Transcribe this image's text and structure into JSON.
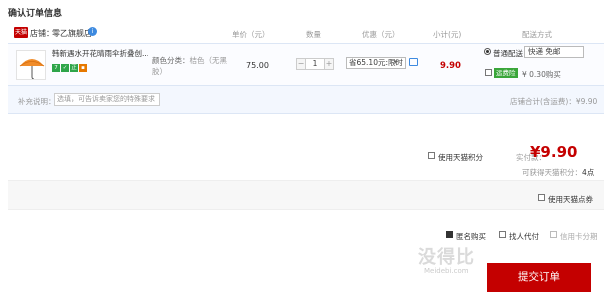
{
  "page_title": "确认订单信息",
  "store": {
    "badge": "天猫",
    "label": "店铺：",
    "name": "零乙旗舰店",
    "info": "i"
  },
  "columns": {
    "unit_price": "单价（元）",
    "quantity": "数量",
    "discount": "优惠（元）",
    "subtotal": "小计(元)",
    "shipping": "配送方式"
  },
  "item": {
    "name": "韩新遇水开花晴雨伞折叠创...",
    "attr_label": "颜色分类：",
    "attr_value": "桔色（无黑胶）",
    "unit_price": "75.00",
    "qty": {
      "minus": "−",
      "value": "1",
      "plus": "+"
    },
    "promo": "省65.10元:限时",
    "subtotal": "9.90",
    "product_color": "#f08c2a",
    "tag_colors": [
      "#2fa54a",
      "#2fa54a",
      "#2fa54a",
      "#e67800"
    ]
  },
  "shipping": {
    "method": "普通配送",
    "carrier": "快递 免邮",
    "return_badge": "运费险",
    "return_price": "¥ 0.30购买"
  },
  "note": {
    "label": "补充说明：",
    "placeholder": "选填，可告诉卖家您的特殊要求"
  },
  "store_total": "店铺合计(含运费)：¥9.90",
  "summary": {
    "use_points": "使用天猫积分",
    "paid_label": "实付款：",
    "paid_value": "¥9.90",
    "points_label": "可获得天猫积分：",
    "points_value": "4点"
  },
  "coupon_label": "使用天猫点券",
  "options": {
    "anonymous": "匿名购买",
    "proxy": "找人代付",
    "installment": "信用卡分期"
  },
  "submit_label": "提交订单",
  "watermark": {
    "main": "没得比",
    "sub": "Meidebi.com"
  },
  "colors": {
    "brand_red": "#c40000",
    "link_blue": "#3d8ae0"
  }
}
